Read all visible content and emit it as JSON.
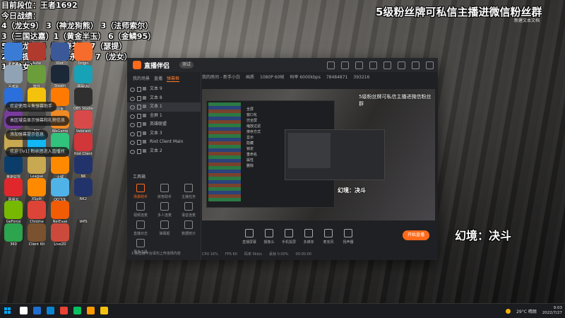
{
  "rank_list": [
    "目前段位：王者1692",
    "今日战绩：",
    "4（龙女9）  3（神龙狗熊）  3（法师索尔）",
    "3（三国达嘉）1（黄金半玉）  6（金鳞95）",
    "5（玉龙）   6（1x泰芬）  7（瑟提）",
    "2（瑟提）   3（决斗永恩）  7（龙女）",
    "1（龙女）"
  ],
  "top_banner": "5级粉丝牌可私信主播进微信粉丝群",
  "top_banner_small": "新建文本文档",
  "stream_overlay_text": "幻境：决斗",
  "desktop_icons": [
    {
      "label": "此电脑",
      "color": "#3a7bd5"
    },
    {
      "label": "Ashe",
      "color": "#b03a2e"
    },
    {
      "label": "Riot",
      "color": "#3b5998"
    },
    {
      "label": "Origin",
      "color": "#f56c2d"
    },
    {
      "label": "回收站",
      "color": "#8fa3b5"
    },
    {
      "label": "软件",
      "color": "#6b9e3a"
    },
    {
      "label": "Steam",
      "color": "#1b2838"
    },
    {
      "label": "网易UU",
      "color": "#17a2b8"
    },
    {
      "label": "腾讯会议",
      "color": "#2a6fdb"
    },
    {
      "label": "YY语音",
      "color": "#f4c20d"
    },
    {
      "label": "斗鱼",
      "color": "#ff7a00"
    },
    {
      "label": "OBS Studio",
      "color": "#2f2f2f"
    },
    {
      "label": "AYR",
      "color": "#7a3b9e"
    },
    {
      "label": "FPS",
      "color": "#444444"
    },
    {
      "label": "WeGame",
      "color": "#f08a24"
    },
    {
      "label": "Valorant",
      "color": "#d84a4a"
    },
    {
      "label": "LOL",
      "color": "#c8a951"
    },
    {
      "label": "QQ",
      "color": "#12b7f5"
    },
    {
      "label": "QQMusic",
      "color": "#31c27c"
    },
    {
      "label": "Riot Client",
      "color": "#d13639"
    },
    {
      "label": "英雄联盟",
      "color": "#0b3d6b"
    },
    {
      "label": "League",
      "color": "#c8a951"
    },
    {
      "label": "火绒",
      "color": "#ff8a00"
    },
    {
      "label": "NK",
      "color": "#22336b"
    },
    {
      "label": "网易云",
      "color": "#e0272b"
    },
    {
      "label": "XSplit",
      "color": "#ff8a00"
    },
    {
      "label": "QQ飞车",
      "color": "#4fb3e8"
    },
    {
      "label": "NK2",
      "color": "#22336b"
    },
    {
      "label": "GeForce",
      "color": "#76b900"
    },
    {
      "label": "Chrome",
      "color": "#db4437"
    },
    {
      "label": "NetEase",
      "color": "#f25c05"
    },
    {
      "label": "WPS",
      "color": "#444"
    },
    {
      "label": "360",
      "color": "#2da44e"
    },
    {
      "label": "Client Kit",
      "color": "#7a5230"
    },
    {
      "label": "Live2D",
      "color": "#cc4a3b"
    }
  ],
  "notifications": [
    "欢迎使用斗鱼弹幕助手",
    "本区域会显示弹幕和礼物信息",
    "添加弹幕提示信息",
    "欢迎 [lv1] 粉丝团进入直播间"
  ],
  "app": {
    "name": "直播伴侣",
    "version_badge": "测试",
    "left_tabs": [
      "我的场景",
      "直播",
      "弹幕框"
    ],
    "active_tab_index": 2,
    "sources": [
      {
        "label": "文本 9",
        "selected": false
      },
      {
        "label": "文本 8",
        "selected": false
      },
      {
        "label": "文本 1",
        "selected": true
      },
      {
        "label": "全屏 1",
        "selected": false
      },
      {
        "label": "英雄联盟",
        "selected": false
      },
      {
        "label": "文本 3",
        "selected": false
      },
      {
        "label": "Riot Client Main",
        "selected": false
      },
      {
        "label": "文本 2",
        "selected": false
      }
    ],
    "tools_label": "工具箱",
    "tools": [
      "场景助手",
      "房管助手",
      "主播任务",
      "视频连麦",
      "多人连麦",
      "语音连麦",
      "直播日志",
      "弹幕姬",
      "数据统计",
      "更多工具"
    ],
    "active_tool_index": 0,
    "footer_note": "1.各直播平台请勿上传违规内容",
    "preview_top": [
      "我的房间 - 新手小白",
      "画质",
      "1080P 60帧",
      "码率 6000kbps",
      "78484871",
      "393216"
    ],
    "preview_banner": "5级粉丝牌可私信主播进微信粉丝群",
    "preview_overlay": "幻境：决斗",
    "nested_menu": [
      "全屏",
      "窗口化",
      "仿全屏",
      "缩放过滤",
      "排序方式",
      "显示",
      "隐藏",
      "锁定",
      "重命名",
      "属性",
      "删除"
    ],
    "controls": [
      "直播屏幕",
      "摄像头",
      "手机投屏",
      "多媒体",
      "麦克风",
      "扬声器"
    ],
    "live_button": "开始直播",
    "status": [
      "CPU 16%",
      "FPS 60",
      "码率 0kb/s",
      "丢帧 0.00%",
      "00:00:00"
    ]
  },
  "taskbar": {
    "apps": [
      "#ffffff",
      "#1f6fd1",
      "#0a84d0",
      "#e94235",
      "#07c160",
      "#ff9a00",
      "#f4c20d"
    ],
    "weather": "29°C 晴朗",
    "time": "9:03",
    "date": "2022/7/27"
  }
}
